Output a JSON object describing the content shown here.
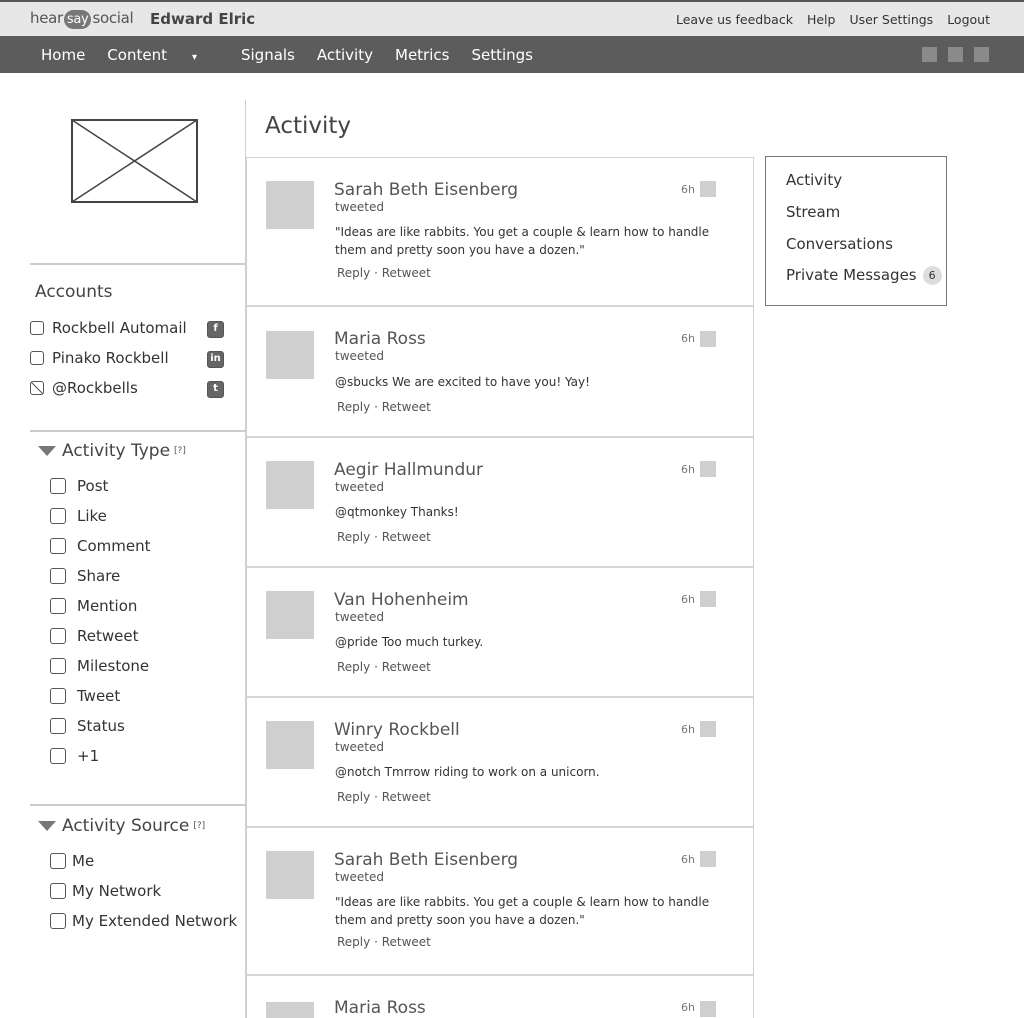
{
  "header": {
    "logo": {
      "hear": "hear",
      "say": "say",
      "social": "social"
    },
    "user_name": "Edward Elric",
    "links": [
      "Leave us feedback",
      "Help",
      "User Settings",
      "Logout"
    ]
  },
  "nav": {
    "items": [
      "Home",
      "Content",
      "Signals",
      "Activity",
      "Metrics",
      "Settings"
    ],
    "content_caret": "▾"
  },
  "sidebar": {
    "accounts_title": "Accounts",
    "accounts": [
      {
        "label": "Rockbell Automail",
        "network": "f",
        "network_icon": "facebook-icon"
      },
      {
        "label": "Pinako Rockbell",
        "network": "in",
        "network_icon": "linkedin-icon"
      },
      {
        "label": "@Rockbells",
        "network": "t",
        "network_icon": "twitter-icon"
      }
    ],
    "activity_type": {
      "title": "Activity Type",
      "help": "[?]",
      "options": [
        "Post",
        "Like",
        "Comment",
        "Share",
        "Mention",
        "Retweet",
        "Milestone",
        "Tweet",
        "Status",
        "+1"
      ]
    },
    "activity_source": {
      "title": "Activity Source",
      "help": "[?]",
      "options": [
        "Me",
        "My Network",
        "My Extended Network"
      ]
    }
  },
  "main": {
    "title": "Activity",
    "reply_label": "Reply",
    "separator": "·",
    "retweet_label": "Retweet",
    "feed": [
      {
        "name": "Sarah Beth Eisenberg",
        "verb": "tweeted",
        "time": "6h",
        "text": "\"Ideas are like rabbits. You get a couple & learn how to handle them and pretty soon you have a dozen.\""
      },
      {
        "name": "Maria Ross",
        "verb": "tweeted",
        "time": "6h",
        "text": "@sbucks We are excited to have you! Yay!"
      },
      {
        "name": "Aegir Hallmundur",
        "verb": "tweeted",
        "time": "6h",
        "text": "@qtmonkey Thanks!"
      },
      {
        "name": "Van Hohenheim",
        "verb": "tweeted",
        "time": "6h",
        "text": "@pride Too much turkey."
      },
      {
        "name": "Winry Rockbell",
        "verb": "tweeted",
        "time": "6h",
        "text": "@notch Tmrrow riding to work on a unicorn."
      },
      {
        "name": "Sarah Beth Eisenberg",
        "verb": "tweeted",
        "time": "6h",
        "text": "\"Ideas are like rabbits. You get a couple & learn how to handle them and pretty soon you have a dozen.\""
      },
      {
        "name": "Maria Ross",
        "verb": "",
        "time": "6h",
        "text": ""
      }
    ]
  },
  "right_panel": {
    "items": [
      "Activity",
      "Stream",
      "Conversations",
      "Private Messages"
    ],
    "private_messages_count": "6"
  }
}
